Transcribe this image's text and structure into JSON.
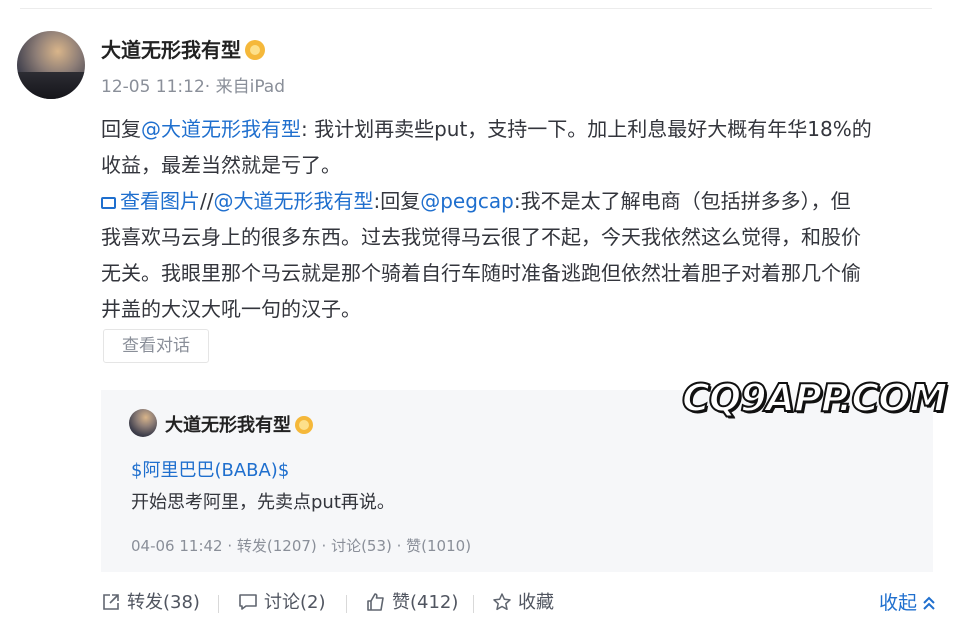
{
  "post": {
    "author": "大道无形我有型",
    "meta": "12-05 11:12· 来自iPad",
    "line1_prefix": "回复",
    "line1_mention": "@大道无形我有型",
    "line1_text": ": 我计划再卖些put，支持一下。加上利息最好大概有年华18%的",
    "line2_text": "收益，最差当然就是亏了。",
    "view_image_label": "查看图片",
    "slash": "//",
    "mention2": "@大道无形我有型",
    "reply_text": ":回复",
    "mention3": "@pegcap",
    "text3a": ":我不是太了解电商（包括拼多多），但",
    "text3b": "我喜欢马云身上的很多东西。过去我觉得马云很了不起，今天我依然这么觉得，和股价",
    "text3c": "无关。我眼里那个马云就是那个骑着自行车随时准备逃跑但依然壮着胆子对着那几个偷",
    "text3d": "井盖的大汉大吼一句的汉子。",
    "view_conversation": "查看对话"
  },
  "quoted": {
    "author": "大道无形我有型",
    "tag": "$阿里巴巴(BABA)$",
    "text": "开始思考阿里，先卖点put再说。",
    "meta": "04-06 11:42   · 转发(1207) · 讨论(53) · 赞(1010)"
  },
  "watermark": "CQ9APP.COM",
  "actions": {
    "repost": "转发(38)",
    "discuss": "讨论(2)",
    "like": "赞(412)",
    "favorite": "收藏",
    "collapse": "收起"
  },
  "colors": {
    "link": "#1f6fce",
    "text": "#33353c",
    "muted": "#8a8f99",
    "quote_bg": "#f6f7f9"
  },
  "icons": [
    "verified-badge-icon",
    "image-icon",
    "share-icon",
    "comment-icon",
    "thumbs-up-icon",
    "star-icon",
    "chevron-up-icon"
  ]
}
